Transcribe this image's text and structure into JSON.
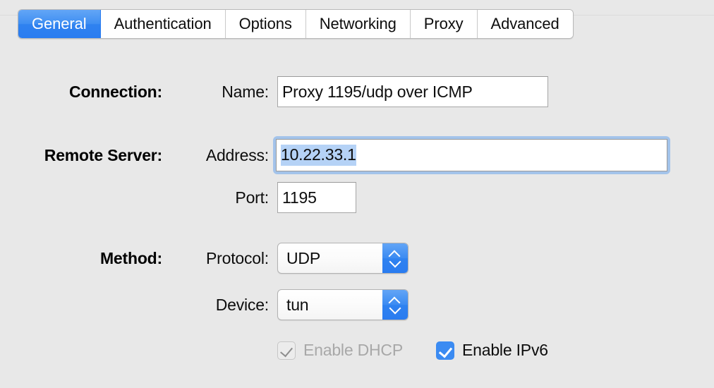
{
  "window": {
    "background_color": "#e8e8e8"
  },
  "tabs": {
    "selected_index": 0,
    "items": [
      {
        "label": "General"
      },
      {
        "label": "Authentication"
      },
      {
        "label": "Options"
      },
      {
        "label": "Networking"
      },
      {
        "label": "Proxy"
      },
      {
        "label": "Advanced"
      }
    ]
  },
  "form": {
    "connection": {
      "group_label": "Connection:",
      "name": {
        "label": "Name:",
        "value": "Proxy 1195/udp over ICMP"
      }
    },
    "remote_server": {
      "group_label": "Remote Server:",
      "address": {
        "label": "Address:",
        "value": "10.22.33.1",
        "focused": true,
        "text_selected": true
      },
      "port": {
        "label": "Port:",
        "value": "1195"
      }
    },
    "method": {
      "group_label": "Method:",
      "protocol": {
        "label": "Protocol:",
        "value": "UDP"
      },
      "device": {
        "label": "Device:",
        "value": "tun"
      },
      "enable_dhcp": {
        "label": "Enable DHCP",
        "checked": true,
        "enabled": false
      },
      "enable_ipv6": {
        "label": "Enable IPv6",
        "checked": true,
        "enabled": true
      }
    }
  },
  "colors": {
    "accent_blue": "#3b8bf2",
    "selection_blue": "#b5d2f6",
    "focus_ring": "#a3c3ea",
    "disabled_gray": "#a8a8a8",
    "background": "#e8e8e8"
  },
  "icons": {
    "stepper_up": "chevron-up-icon",
    "stepper_down": "chevron-down-icon",
    "checkmark": "check-icon"
  }
}
